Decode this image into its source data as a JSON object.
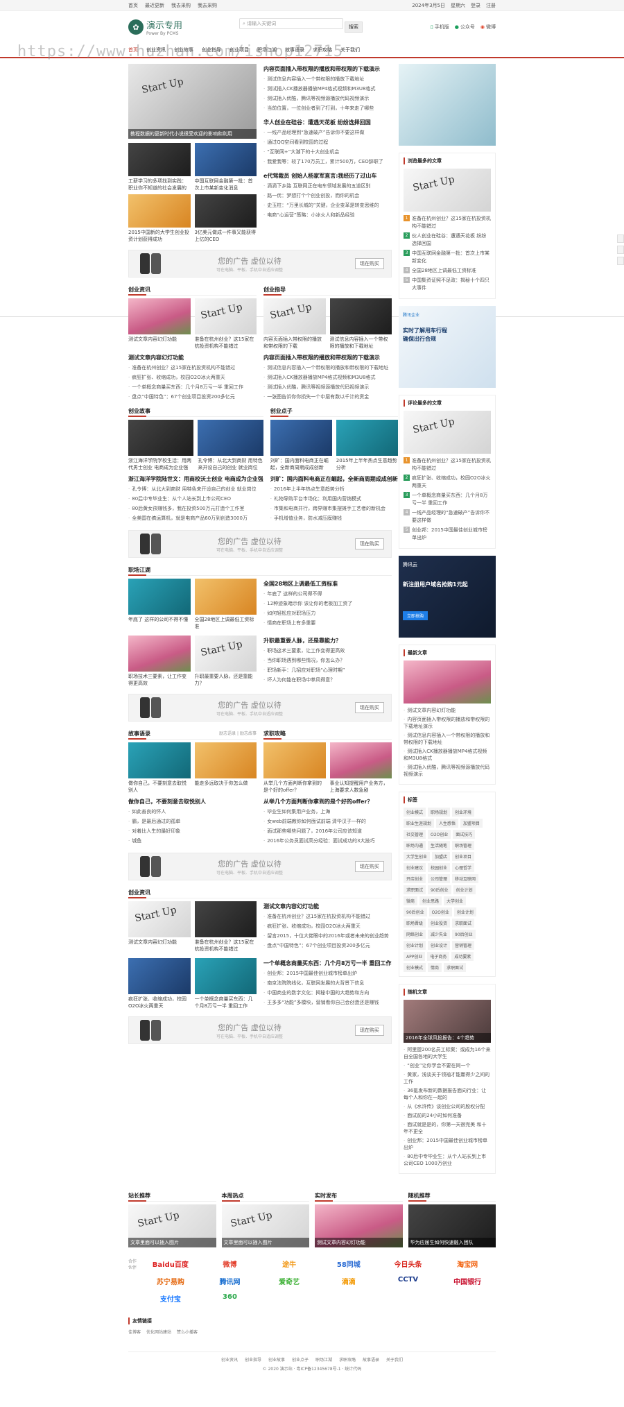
{
  "topbar": {
    "left": [
      "首页",
      "最近更新",
      "我去采购",
      "我去采购"
    ],
    "right": [
      "2024年3月5日",
      "星期六",
      "登录",
      "注册"
    ]
  },
  "header": {
    "logo_cn": "演示专用",
    "logo_en": "Power By PCMS",
    "search_placeholder": "请输入关键词",
    "search_btn": "搜索",
    "phone": "手机版",
    "wechat": "公众号",
    "weibo": "微博"
  },
  "nav": [
    "首页",
    "创业资讯",
    "创业故事",
    "创业指导",
    "创业项目",
    "职场江湖",
    "故事语录",
    "求职攻略",
    "关于我们"
  ],
  "watermark": "https://www.huzhan.com/ishop12715",
  "top": {
    "slide_caption": "教程数据的更新时代小说很受欢迎的影响和利用",
    "thumbs": [
      {
        "t": "工薪学习的多项找到实践：职业你不知道的社会发展的"
      },
      {
        "t": "中国互联网金融第一批：首次上市某新变化消息"
      },
      {
        "t": "2015中国新的大学生创业投资计划获得成功"
      },
      {
        "t": "3亿美元做成一件事又能获得上亿的CEO"
      }
    ],
    "groups": [
      {
        "h": "内容页面插入带权限的播放和带权限的下载演示",
        "items": [
          "测试信息内容插入一个带权限的播放下载地址",
          "测试插入CK播放器播放MP4格式视频和M3U8格式",
          "测试插入优酷，腾讯等视频源播放代码视频演示",
          "当前位置，一位创业者到了打到，十年来走了哪些"
        ]
      },
      {
        "h": "华人创业在硅谷：遭遇天花板 纷纷选择回国",
        "items": [
          "一线产品经理到“急速破产”告诉你不要这样做",
          "通过QQ空间看到校园的过程",
          "“互联网+”大潮下的十大创业机会",
          "我爱我等：较了170万员工，累计500万，CEO辞职了"
        ]
      },
      {
        "h": "e代驾裁员 创始人杨家军直言:我经历了过山车",
        "items": [
          "滴滴下乡路 互联网正在电车领域发展的五道区别",
          "路一优：梦想打个个创业创投，而你的机会",
          "史玉柱：“万里长城的”关键，企业变革是转变思维的",
          "电商“心运营”策略：小冰火人和新品经验"
        ]
      }
    ]
  },
  "ads": [
    {
      "title": "您的广告 虚位以待",
      "sub": "可在电脑、平板、手机中自适应调整",
      "btn": "现在购买"
    }
  ],
  "side_banner_1": "",
  "side_top": {
    "title": "浏览最多的文章",
    "items": [
      "准备在杭州创业？这15家在杭投资机构不能错过",
      "伙人创业在硅谷：遭遇天花板 纷纷选择回国",
      "中国互联网金融第一批：首次上市某新变化",
      "全国28地区上调最低工资标准",
      "中国集资证照不足政：揭秘十个四只大事件"
    ]
  },
  "sections": [
    {
      "head": "创业资讯",
      "thumbs": [
        "测试文章内容幻灯功能",
        "准备在杭州创业？这15家在杭投资机构不能错过"
      ],
      "h": "测试文章内容幻灯功能",
      "items": [
        "准备在杭州创业？这15家在杭投资机构不能错过",
        "疯狂扩张、收缩成功，校园O2O冰火两重天",
        "一个单概念商量买东西：几个月8万亏一半 重回工作",
        "盘点“中国特色”：67个创业项目投资200多亿元"
      ]
    },
    {
      "head": "创业指导",
      "thumbs": [
        "内容页面插入带权限的播放和带权限的下载",
        "测试信息内容插入一个带权限的播放和下载地址"
      ],
      "h": "内容页面插入带权限的播放和带权限的下载演示",
      "items": [
        "测试信息内容插入一个带权限的播放和带权限的下载地址",
        "测试插入CK播放器播放MP4格式视频和M3U8格式",
        "测试插入优酷，腾讯等视频源播放代码视频演示",
        "一张图告诉你你损失一个中层有数以千计的资金"
      ]
    },
    {
      "head": "创业故事",
      "thumbs": [
        "浙江海洋学院学校生活：用两代男士创业 电商成为企业强",
        "孔令博：从北大到商财 用特色来开设自己的创业 就业岗位"
      ],
      "h": "浙江海洋学院陆世文：用商校沃土创业 电商成为企业强",
      "items": [
        "孔令博：从北大到商财 用特色来开设自己的创业 就业岗位",
        "80后中专毕业生：从个人站长到上市公司CEO",
        "80后黄女孩赚钱多，我在投资500万元打造个工作室",
        "全美国在搞运算机，就是电商产品60万到创造3000万"
      ]
    },
    {
      "head": "创业点子",
      "thumbs": [
        "刘旷：国内面料电商正在崛起，全新商周期成成创新",
        "2015年上半年热点生意趋势分析"
      ],
      "h": "刘旷：国内面料电商正在崛起，全新商周期成成创新",
      "items": [
        "2016年上半年热点生意趋势分析",
        "礼物导购平台市场化：利用国内营销模式",
        "市集和电商并行，跨界赚市集摆摊手工艺者的新机会",
        "手机增值业务，防水减压膜赚钱"
      ]
    },
    {
      "head": "职场江湖",
      "thumbs": [
        "年底了 这样的公司不得不懂",
        "全国28地区上调最低工资标准",
        "职场技术三要素，让工作变得更高效",
        "升职最重要人脉，还是靠能力？"
      ],
      "groups": [
        {
          "h": "全国28地区上调最低工资标准",
          "items": [
            "年底了 这样的公司得不得",
            "12种迹象暗示你 该让你的老板加工资了",
            "如何轻松应对职场压力",
            "情商在职场上有多重要"
          ]
        },
        {
          "h": "升职最重要人脉，还是靠能力？",
          "items": [
            "职场这术三要素，让工作变得更高效",
            "当你职场遇到哪些情况，你怎么办？",
            "职场新手：几招应对职场“心理时期”",
            "坏人为何能在职场中拳风得意？"
          ]
        }
      ]
    },
    {
      "head": "故事语录",
      "more": [
        "励志语录",
        "励志故事"
      ],
      "thumbs": [
        "做你自己，不要刻意去取悦别人",
        "能走多远取决于你怎么做"
      ],
      "h": "做你自己，不要刻意去取悦别人",
      "items": [
        "如此善良的怀人",
        "霸，是最后通过的孤单",
        "对着比人生的最好印象",
        "城鱼"
      ]
    },
    {
      "head": "求职攻略",
      "thumbs": [
        "从举几个方面判断你拿到的是个好的offer？",
        "事业认知提醒用户业务方，上海要求人数急剧"
      ],
      "h": "从举几个方面判断你拿到的是个好的offer？",
      "items": [
        "毕业生如何集用户业务，上海",
        "女web前端教你如何面试前端 清华汉子一样的",
        "面试那些哪些问题了，2016年公司应该知道",
        "2016年公务员面试高分经验：面试成功的3大技巧"
      ]
    },
    {
      "head": "创业资讯",
      "thumbs": [
        "测试文章内容幻灯功能",
        "准备在杭州创业？这15家在杭投资机构不能错过",
        "疯狂扩张、收缩成功，校园O2O冰火两重天",
        "一个单概念商量买东西：几个月8万亏一半 重回工作"
      ],
      "groups": [
        {
          "h": "测试文章内容幻灯功能",
          "items": [
            "准备在杭州创业？这15家在杭投资机构不能错过",
            "疯狂扩张、收缩成功，校园O2O冰火两重天",
            "留言2015，十位大佬眼中的2016年或者未来的创业趋势",
            "盘点“中国特色”：67个创业项目投资200多亿元"
          ]
        },
        {
          "h": "一个单概念商量买东西：几个月8万亏一半 重回工作",
          "items": [
            "创业邦：2015中国最佳创业城市榜单出炉",
            "南京法院院线化，互联网发展的大背景下信息",
            "中国商业的数字文化：揭秘中国的大趋势和方向",
            "王多多“功能”多模块，营销看你自己会创造还是赚钱"
          ]
        }
      ]
    }
  ],
  "side_ad_banner": {
    "brand": "腾讯企业",
    "t1": "实时了解用车行程",
    "t2": "确保出行合规"
  },
  "side_comments": {
    "title": "评论最多的文章",
    "items": [
      "准备在杭州创业？这15家在杭投资机构不能错过",
      "疯狂扩张、收缩成功，校园O2O冰火两重天",
      "一个单概念商量买东西：几个月8万亏一半 重回工作",
      "一线产品经理的“急速破产”告诉你不要这样做",
      "创业邦：2015中国最佳创业城市榜单出炉"
    ]
  },
  "side_cloud": {
    "brand": "腾讯云",
    "t1": "新注册用户域名抢购1元起",
    ".t2": ".com首年28元 .cn首年9元",
    "btn": "立即抢购"
  },
  "side_latest": {
    "title": "最新文章",
    "items": [
      "测试文章内容幻灯功能",
      "内容页面插入带权限的播放和带权限的下载地址演示",
      "测试信息内容插入一个带权限的播放和带权限的下载地址",
      "测试插入CK播放器播放MP4格式视频和M3U8格式",
      "测试插入优酷，腾讯等视频源播放代码视频演示"
    ]
  },
  "side_tags": {
    "title": "标签",
    "tags": [
      "创业模式",
      "职场规划",
      "创业环境",
      "职业生涯规划",
      "人生感悟",
      "加盟项目",
      "社交管理",
      "O2O创业",
      "面试技巧",
      "职场沟通",
      "生活随笔",
      "职场管理",
      "大学生创业",
      "加盟店",
      "创业项目",
      "创业建议",
      "校园创业",
      "心理哲学",
      "开店创业",
      "公司管理",
      "移动互联网",
      "求职面试",
      "90后创业",
      "创业计划",
      "微商",
      "创业思路",
      "大学创业",
      "90后创业",
      "O2O创业",
      "创业计划",
      "职场晋级",
      "创业投资",
      "求职面试",
      "网络创业",
      "减少失业",
      "90后创业",
      "创业计划",
      "创业设计",
      "营销管理",
      "APP创业",
      "电子商务",
      "成功要素",
      "创业模式",
      "情商",
      "求职面试"
    ]
  },
  "side_random": {
    "title": "随机文章",
    "caption": "2016年全球风投报告：4个趋势",
    "items": [
      "阿里盟200名员工标案：或成为16个来自全国各地的大学生",
      "“创业”让你学会不要在同一个",
      "黄家，浅谈关于领袖才能赢得少之间的工作",
      "36氪发布新的数据报告面向行业：让每个人和你在一起的",
      "从《水浒传》谈创业公司的股权分配",
      "面试前的24小时如何准备",
      "面试就是是的，你第一天很完美 和十年不更全",
      "创业邦：2015中国最佳创业城市榜单出炉",
      "80后中专毕业生：从个人站长到上市公司CEO 1000万创业"
    ]
  },
  "bottom4": [
    {
      "head": "站长推荐",
      "cap": "文章里面可以插入图片"
    },
    {
      "head": "本周热点",
      "cap": "文章里面可以插入图片"
    },
    {
      "head": "实时发布",
      "cap": "测试文章内容幻灯功能"
    },
    {
      "head": "随机推荐",
      "cap": "华为应届生如何快速融入团队"
    }
  ],
  "partners": {
    "label": "合作伙伴",
    "items": [
      "Baidu百度",
      "微博",
      "途牛",
      "58同城",
      "今日头条",
      "淘宝网",
      "苏宁易购",
      "腾讯网",
      "爱奇艺",
      "滴滴",
      "CCTV",
      "中国银行",
      "支付宝",
      "360"
    ]
  },
  "friend": {
    "title": "友情链接",
    "links": [
      "佳博客",
      "优化网站建站",
      "赞么小播客"
    ]
  },
  "footer": {
    "links": [
      "创业资讯",
      "创业指导",
      "创业故事",
      "创业点子",
      "职场江湖",
      "求职攻略",
      "故事语录",
      "关于我们"
    ],
    "copy": "© 2020 演示站 · 粤ICP备12345678号-1 · 统计代码"
  }
}
